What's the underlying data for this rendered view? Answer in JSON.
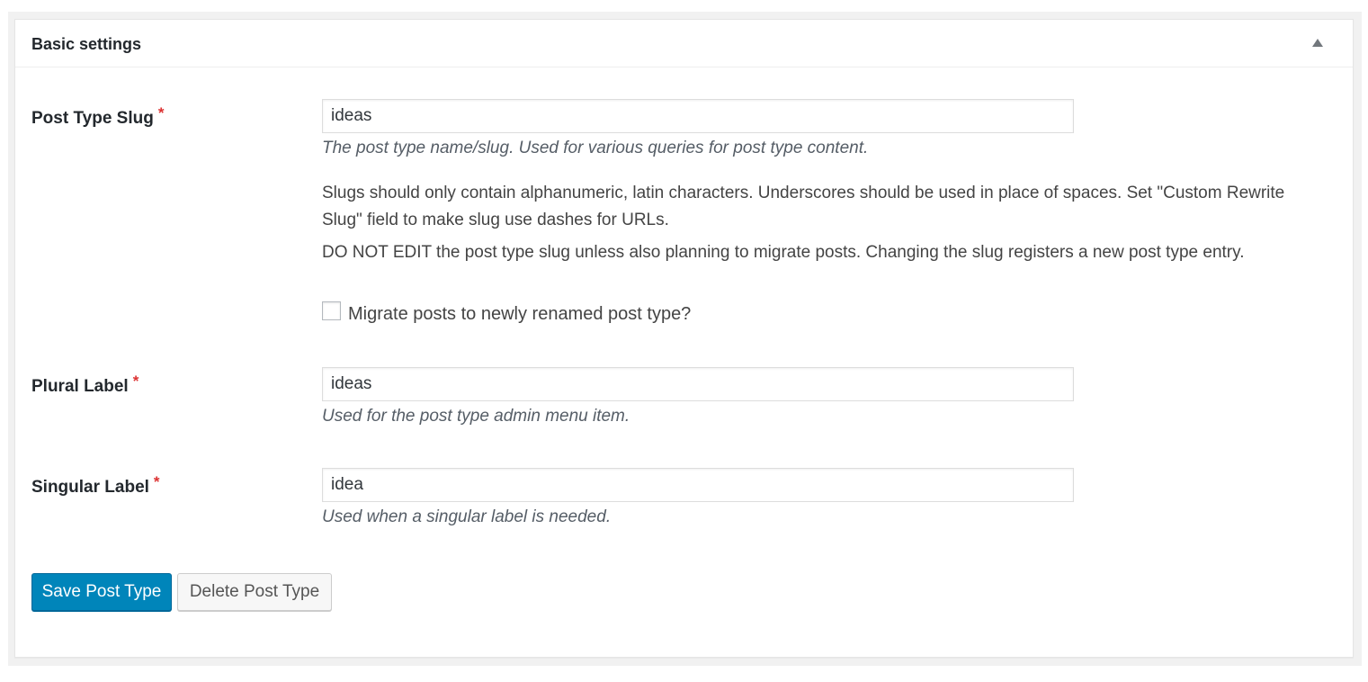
{
  "panel": {
    "title": "Basic settings"
  },
  "fields": {
    "post_type_slug": {
      "label": "Post Type Slug",
      "required": "*",
      "value": "ideas",
      "description": "The post type name/slug. Used for various queries for post type content.",
      "note1": "Slugs should only contain alphanumeric, latin characters. Underscores should be used in place of spaces. Set \"Custom Rewrite Slug\" field to make slug use dashes for URLs.",
      "note2": "DO NOT EDIT the post type slug unless also planning to migrate posts. Changing the slug registers a new post type entry.",
      "migrate_label": "Migrate posts to newly renamed post type?"
    },
    "plural_label": {
      "label": "Plural Label",
      "required": "*",
      "value": "ideas",
      "description": "Used for the post type admin menu item."
    },
    "singular_label": {
      "label": "Singular Label",
      "required": "*",
      "value": "idea",
      "description": "Used when a singular label is needed."
    }
  },
  "buttons": {
    "save": "Save Post Type",
    "delete": "Delete Post Type"
  },
  "colors": {
    "primary": "#0085ba",
    "required": "#dc3232"
  },
  "icons": {
    "toggle": "triangle-up-icon"
  }
}
